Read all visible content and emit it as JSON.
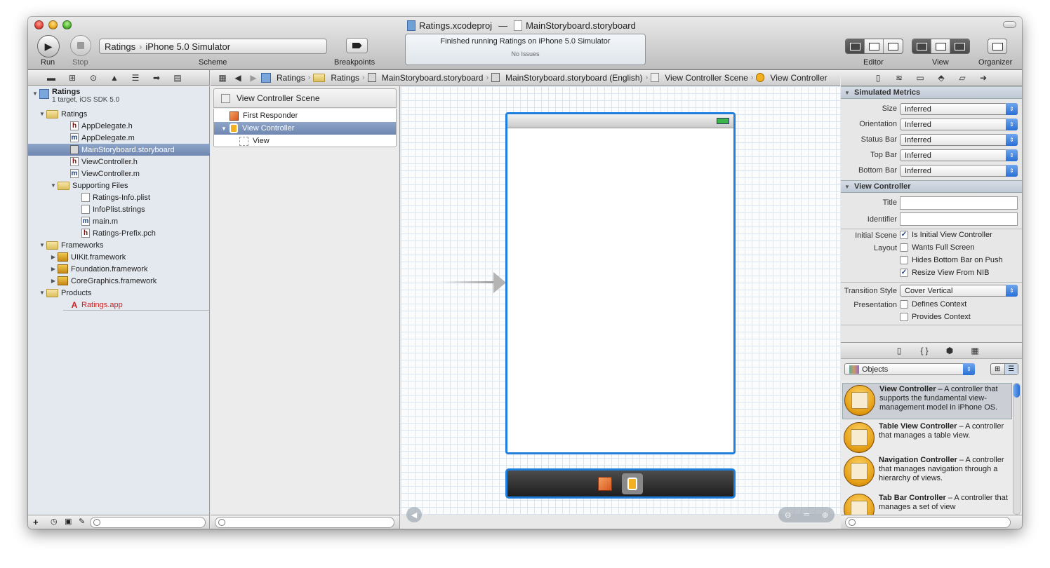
{
  "window": {
    "title_project": "Ratings.xcodeproj",
    "title_dash": "—",
    "title_file": "MainStoryboard.storyboard"
  },
  "toolbar": {
    "run_label": "Run",
    "stop_label": "Stop",
    "scheme_target": "Ratings",
    "scheme_destination": "iPhone 5.0 Simulator",
    "scheme_label": "Scheme",
    "breakpoints_label": "Breakpoints",
    "activity_message": "Finished running Ratings on iPhone 5.0 Simulator",
    "activity_issues": "No Issues",
    "editor_label": "Editor",
    "view_label": "View",
    "organizer_label": "Organizer"
  },
  "jumpbar": {
    "crumbs": [
      "Ratings",
      "Ratings",
      "MainStoryboard.storyboard",
      "MainStoryboard.storyboard (English)",
      "View Controller Scene",
      "View Controller"
    ]
  },
  "navigator": {
    "project_name": "Ratings",
    "project_sub": "1 target, iOS SDK 5.0",
    "items": [
      {
        "label": "Ratings",
        "kind": "folder"
      },
      {
        "label": "AppDelegate.h",
        "kind": "h"
      },
      {
        "label": "AppDelegate.m",
        "kind": "m"
      },
      {
        "label": "MainStoryboard.storyboard",
        "kind": "storyboard",
        "selected": true
      },
      {
        "label": "ViewController.h",
        "kind": "h"
      },
      {
        "label": "ViewController.m",
        "kind": "m"
      },
      {
        "label": "Supporting Files",
        "kind": "folder"
      },
      {
        "label": "Ratings-Info.plist",
        "kind": "plist"
      },
      {
        "label": "InfoPlist.strings",
        "kind": "strings"
      },
      {
        "label": "main.m",
        "kind": "m"
      },
      {
        "label": "Ratings-Prefix.pch",
        "kind": "h"
      },
      {
        "label": "Frameworks",
        "kind": "folder"
      },
      {
        "label": "UIKit.framework",
        "kind": "framework"
      },
      {
        "label": "Foundation.framework",
        "kind": "framework"
      },
      {
        "label": "CoreGraphics.framework",
        "kind": "framework"
      },
      {
        "label": "Products",
        "kind": "folder"
      },
      {
        "label": "Ratings.app",
        "kind": "app"
      }
    ]
  },
  "outline": {
    "scene_title": "View Controller Scene",
    "items": [
      {
        "label": "First Responder"
      },
      {
        "label": "View Controller",
        "selected": true
      },
      {
        "label": "View"
      }
    ]
  },
  "inspector": {
    "simulated_metrics_header": "Simulated Metrics",
    "metrics": [
      {
        "label": "Size",
        "value": "Inferred"
      },
      {
        "label": "Orientation",
        "value": "Inferred"
      },
      {
        "label": "Status Bar",
        "value": "Inferred"
      },
      {
        "label": "Top Bar",
        "value": "Inferred"
      },
      {
        "label": "Bottom Bar",
        "value": "Inferred"
      }
    ],
    "vc_header": "View Controller",
    "title_label": "Title",
    "identifier_label": "Identifier",
    "initial_scene_label": "Initial Scene",
    "is_initial_label": "Is Initial View Controller",
    "layout_label": "Layout",
    "wants_full_screen_label": "Wants Full Screen",
    "hides_bottom_bar_label": "Hides Bottom Bar on Push",
    "resize_view_label": "Resize View From NIB",
    "transition_style_label": "Transition Style",
    "transition_style_value": "Cover Vertical",
    "presentation_label": "Presentation",
    "defines_context_label": "Defines Context",
    "provides_context_label": "Provides Context",
    "checks": {
      "is_initial": true,
      "wants_full_screen": false,
      "hides_bottom_bar": false,
      "resize_view": true,
      "defines_context": false,
      "provides_context": false
    }
  },
  "library": {
    "selector_value": "Objects",
    "items": [
      {
        "name": "View Controller",
        "desc": " – A controller that supports the fundamental view-management model in iPhone OS."
      },
      {
        "name": "Table View Controller",
        "desc": " – A controller that manages a table view."
      },
      {
        "name": "Navigation Controller",
        "desc": " – A controller that manages navigation through a hierarchy of views."
      },
      {
        "name": "Tab Bar Controller",
        "desc": " – A controller that manages a set of view"
      }
    ]
  },
  "colors": {
    "selection_blue": "#1e7ede",
    "missing_product_red": "#cc2222"
  }
}
